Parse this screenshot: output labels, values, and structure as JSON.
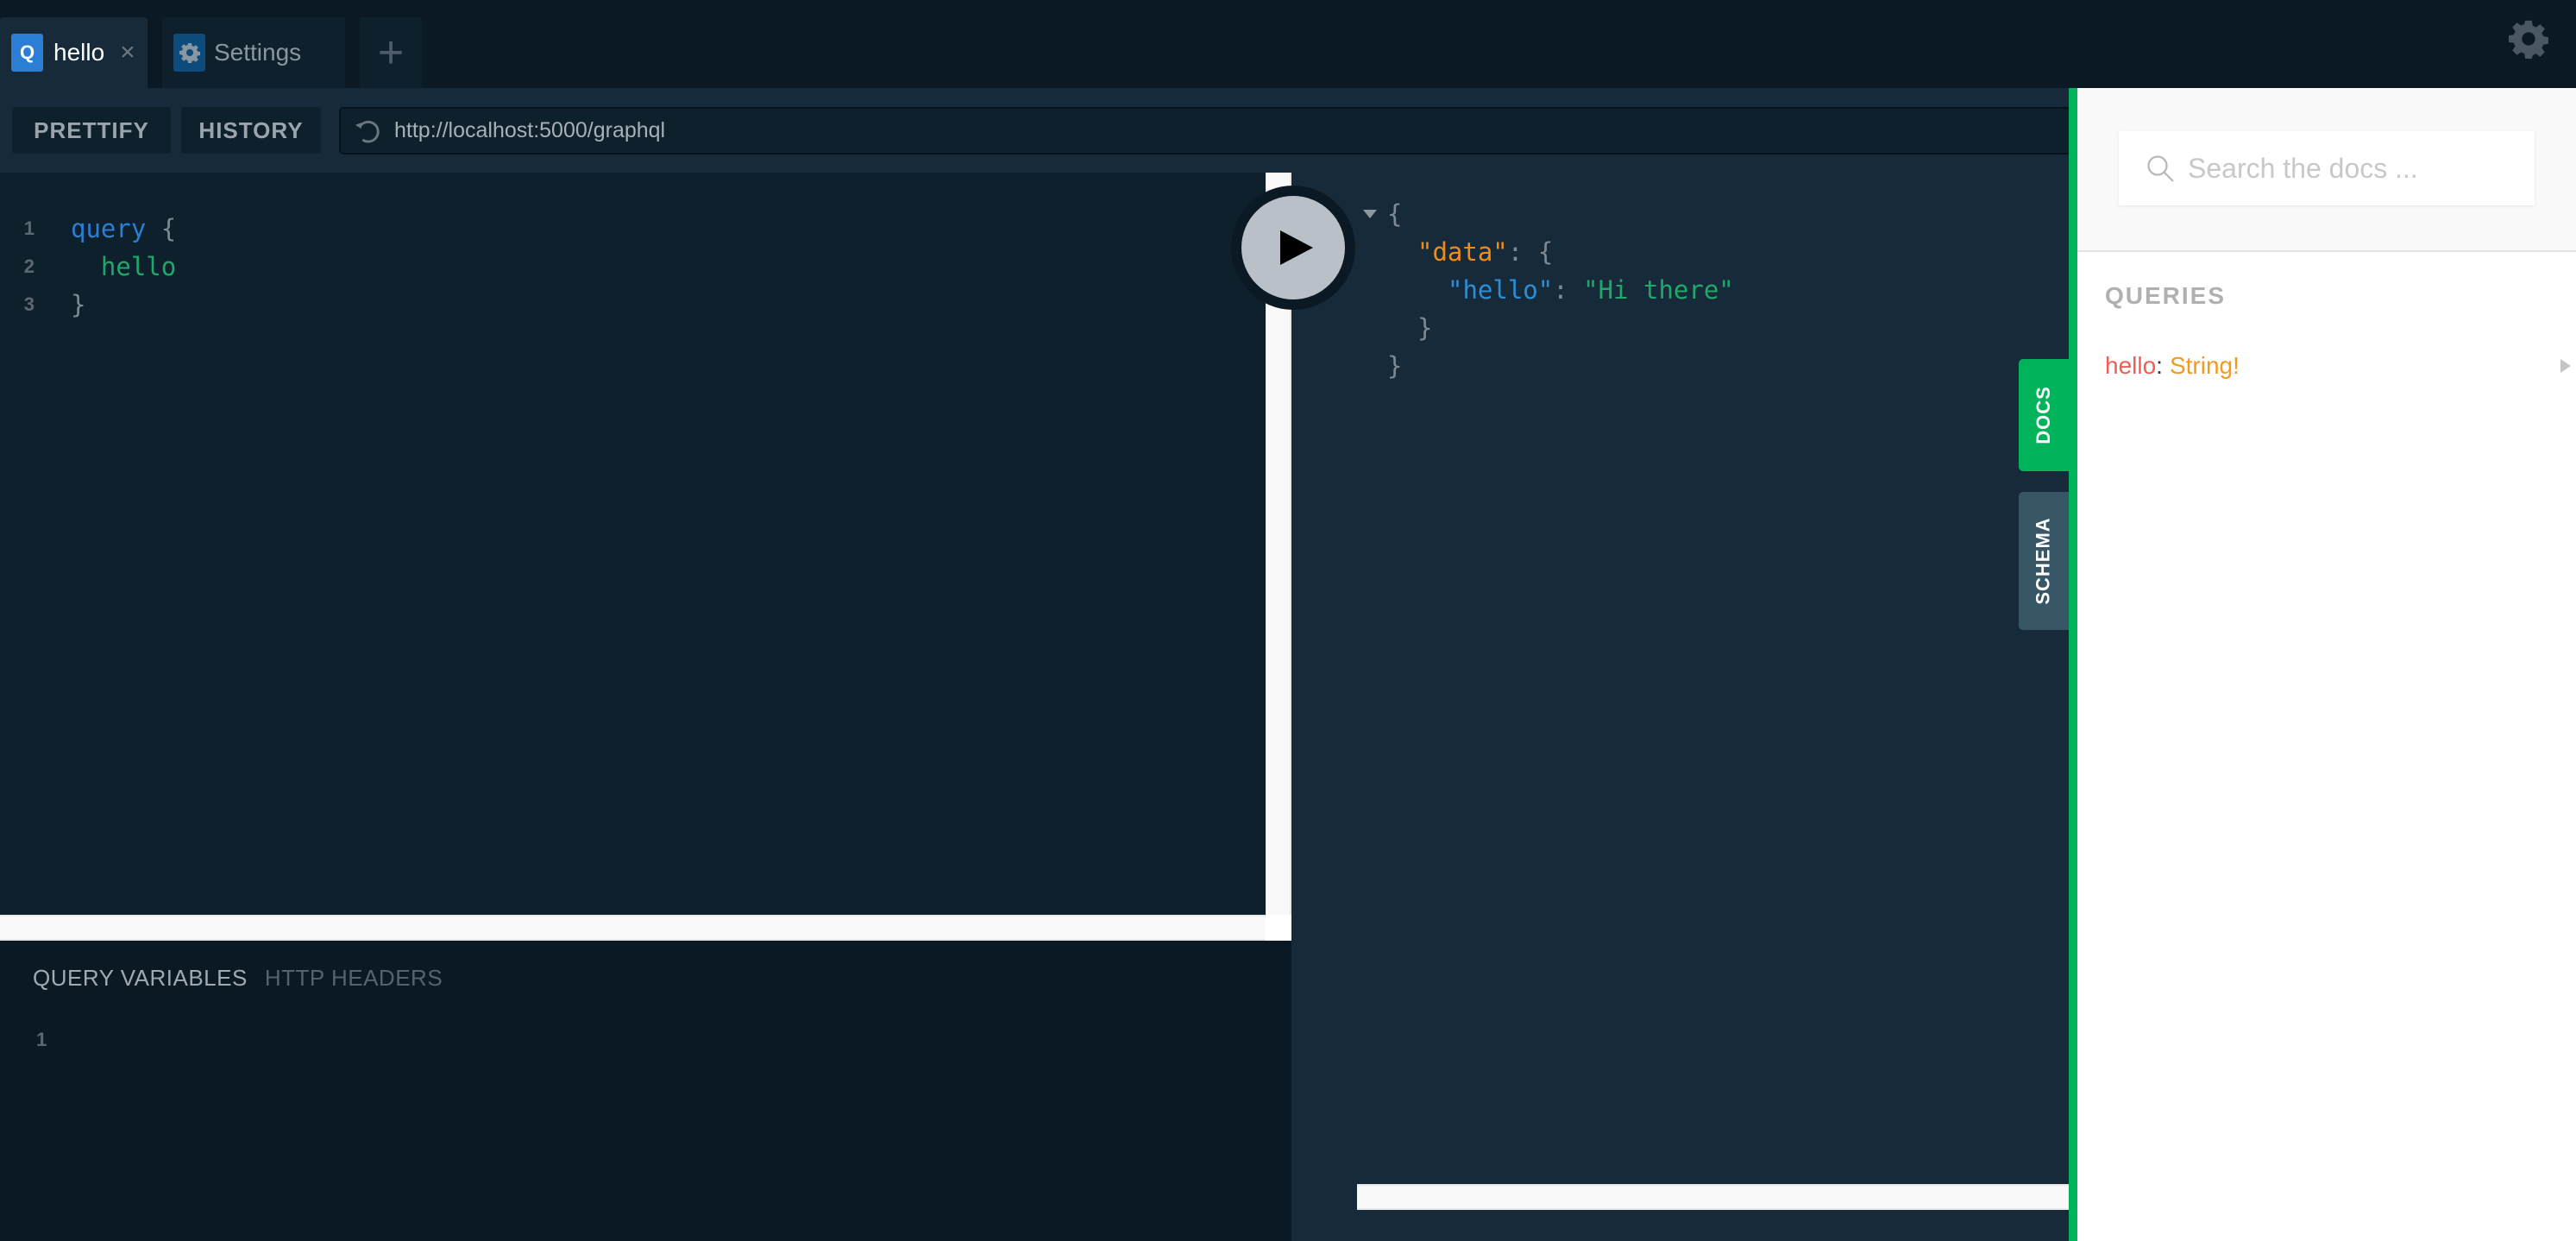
{
  "tabs": [
    {
      "badge": "Q",
      "label": "hello",
      "close": "×",
      "active": true
    },
    {
      "badge_icon": "gear-icon",
      "label": "Settings",
      "active": false
    }
  ],
  "add_tab": "+",
  "toolbar": {
    "prettify_label": "PRETTIFY",
    "history_label": "HISTORY",
    "endpoint_url": "http://localhost:5000/graphql"
  },
  "query_editor": {
    "lines": [
      {
        "number": "1",
        "tokens": [
          {
            "text": "query",
            "kind": "keyword"
          },
          {
            "text": " {",
            "kind": "punct"
          }
        ]
      },
      {
        "number": "2",
        "tokens": [
          {
            "text": "  hello",
            "kind": "field"
          }
        ]
      },
      {
        "number": "3",
        "tokens": [
          {
            "text": "}",
            "kind": "punct"
          }
        ]
      }
    ]
  },
  "variables_panel": {
    "active_tab": "QUERY VARIABLES",
    "other_tab": "HTTP HEADERS",
    "line_number": "1"
  },
  "result": {
    "lines": [
      {
        "text_open": "{"
      },
      {
        "key": "\"data\"",
        "sep": ": ",
        "open": "{"
      },
      {
        "key": "\"hello\"",
        "sep": ": ",
        "value": "\"Hi there\""
      },
      {
        "close": "}"
      },
      {
        "close": "}"
      }
    ]
  },
  "side_tabs": {
    "docs_label": "DOCS",
    "schema_label": "SCHEMA"
  },
  "docs": {
    "search_placeholder": "Search the docs ...",
    "section_title": "QUERIES",
    "items": [
      {
        "name": "hello",
        "colon": ":",
        "type": "String!"
      }
    ]
  },
  "colors": {
    "accent_green": "#00b35a",
    "query_badge": "#2a7ed3",
    "keyword": "#2a7ed3",
    "field": "#1fa86a",
    "json_key_data": "#ef8d1b",
    "json_key_hello": "#2a8fd8",
    "json_string": "#1fa86a"
  }
}
